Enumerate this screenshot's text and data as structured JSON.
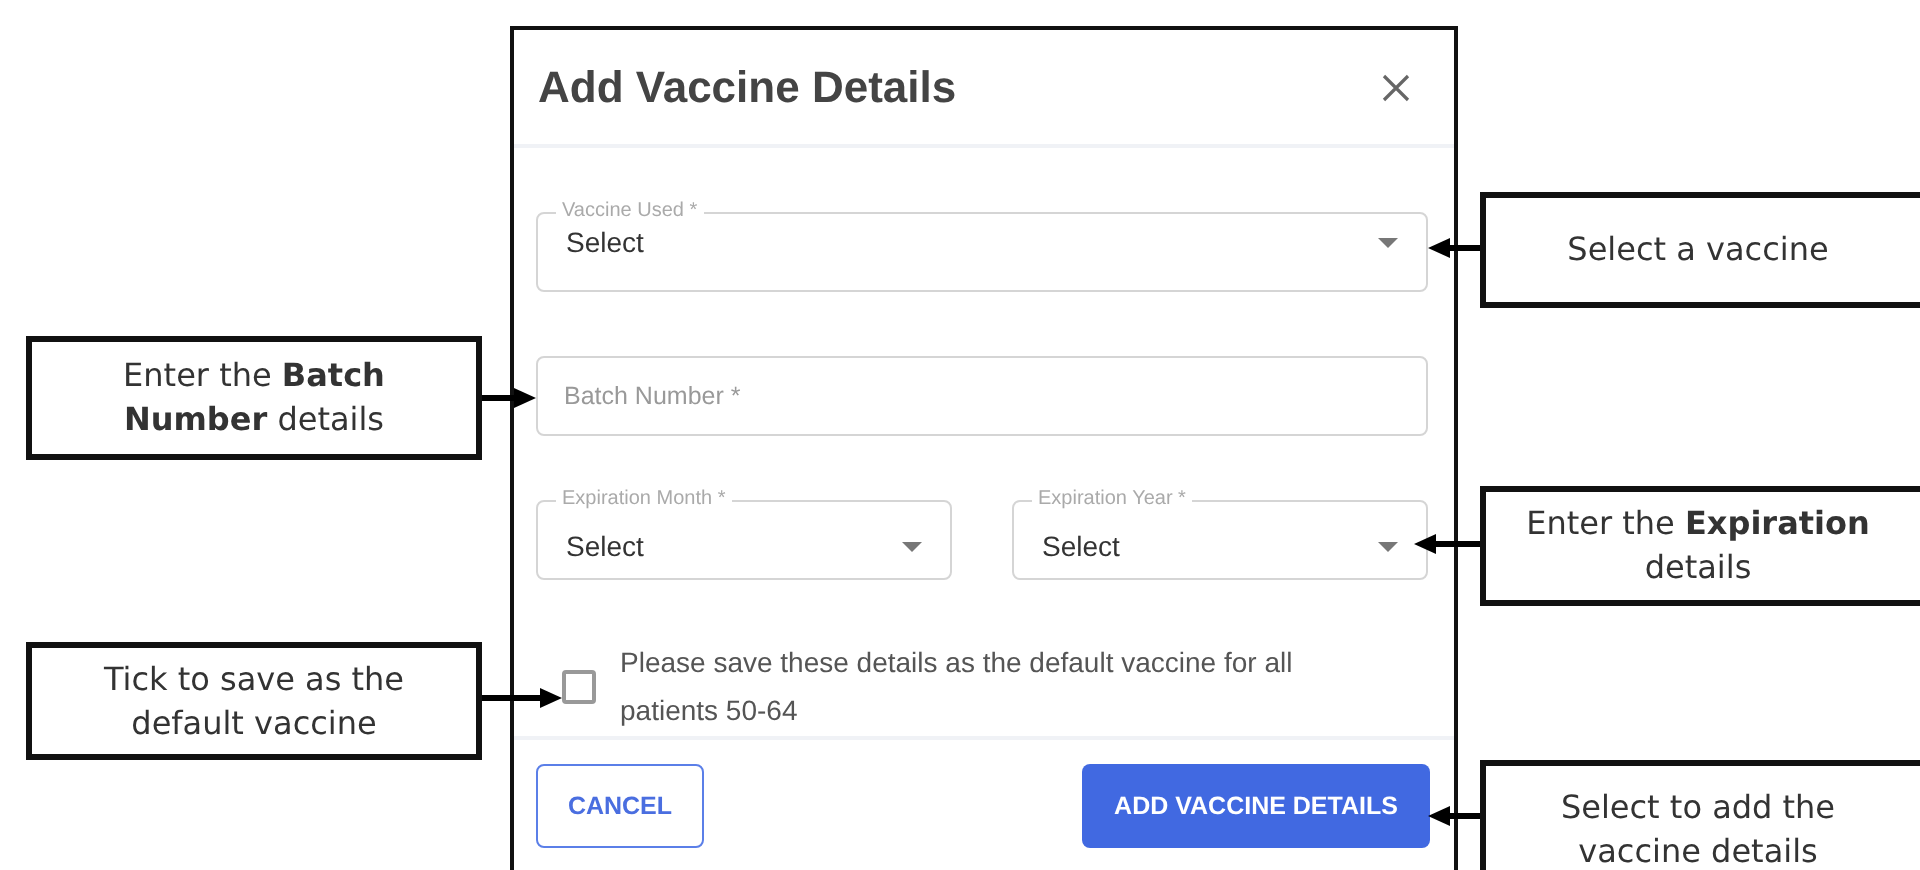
{
  "dialog": {
    "title": "Add Vaccine Details",
    "vaccine_used": {
      "label": "Vaccine Used *",
      "value": "Select"
    },
    "batch_number": {
      "placeholder": "Batch Number *"
    },
    "expiration": [
      {
        "label": "Expiration Month *",
        "value": "Select"
      },
      {
        "label": "Expiration Year *",
        "value": "Select"
      }
    ],
    "default_checkbox": {
      "label": "Please save these details as the default vaccine for all patients 50-64",
      "checked": false
    },
    "buttons": [
      {
        "kind": "outlined",
        "label": "CANCEL"
      },
      {
        "kind": "filled",
        "label": "ADD VACCINE DETAILS"
      }
    ]
  },
  "callouts": [
    {
      "kind": "left",
      "text": "Enter the **Batch Number** details"
    },
    {
      "kind": "left",
      "text": "Tick to save as the default vaccine"
    },
    {
      "kind": "right",
      "text": "Select a vaccine"
    },
    {
      "kind": "right",
      "text": "Enter the **Expiration** details"
    },
    {
      "kind": "right",
      "text": "Select to add the vaccine details"
    }
  ]
}
